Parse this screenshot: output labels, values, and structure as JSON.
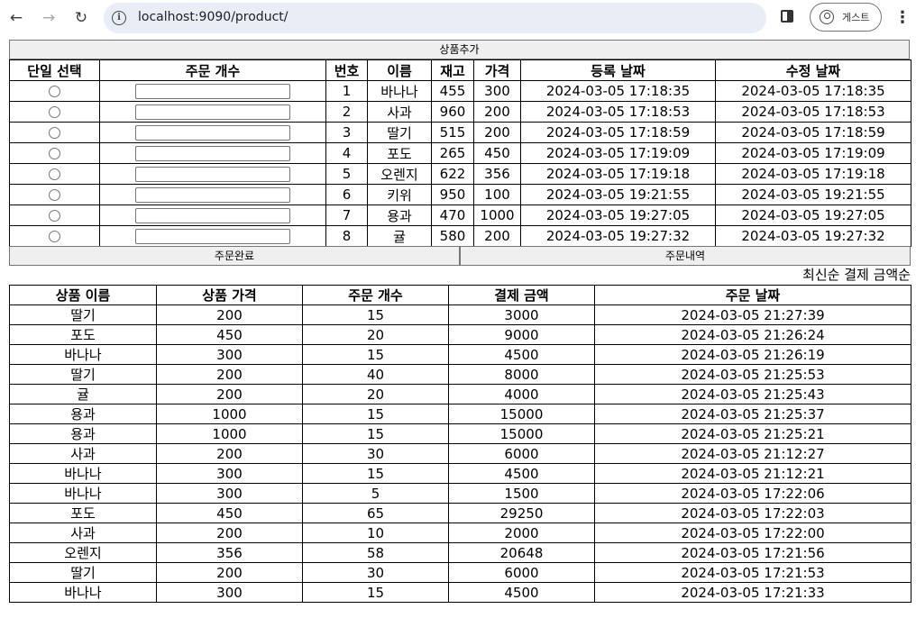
{
  "browser": {
    "url": "localhost:9090/product/",
    "profile_label": "게스트"
  },
  "add_button": "상품추가",
  "product_table": {
    "headers": [
      "단일 선택",
      "주문 개수",
      "번호",
      "이름",
      "재고",
      "가격",
      "등록 날짜",
      "수정 날짜"
    ],
    "rows": [
      [
        "1",
        "바나나",
        "455",
        "300",
        "2024-03-05 17:18:35",
        "2024-03-05 17:18:35"
      ],
      [
        "2",
        "사과",
        "960",
        "200",
        "2024-03-05 17:18:53",
        "2024-03-05 17:18:53"
      ],
      [
        "3",
        "딸기",
        "515",
        "200",
        "2024-03-05 17:18:59",
        "2024-03-05 17:18:59"
      ],
      [
        "4",
        "포도",
        "265",
        "450",
        "2024-03-05 17:19:09",
        "2024-03-05 17:19:09"
      ],
      [
        "5",
        "오렌지",
        "622",
        "356",
        "2024-03-05 17:19:18",
        "2024-03-05 17:19:18"
      ],
      [
        "6",
        "키위",
        "950",
        "100",
        "2024-03-05 19:21:55",
        "2024-03-05 19:21:55"
      ],
      [
        "7",
        "용과",
        "470",
        "1000",
        "2024-03-05 19:27:05",
        "2024-03-05 19:27:05"
      ],
      [
        "8",
        "귤",
        "580",
        "200",
        "2024-03-05 19:27:32",
        "2024-03-05 19:27:32"
      ]
    ]
  },
  "order_complete_button": "주문완료",
  "order_history_button": "주문내역",
  "sort_options": [
    "최신순",
    "결제 금액순"
  ],
  "order_table": {
    "headers": [
      "상품 이름",
      "상품 가격",
      "주문 개수",
      "결제 금액",
      "주문 날짜"
    ],
    "rows": [
      [
        "딸기",
        "200",
        "15",
        "3000",
        "2024-03-05 21:27:39"
      ],
      [
        "포도",
        "450",
        "20",
        "9000",
        "2024-03-05 21:26:24"
      ],
      [
        "바나나",
        "300",
        "15",
        "4500",
        "2024-03-05 21:26:19"
      ],
      [
        "딸기",
        "200",
        "40",
        "8000",
        "2024-03-05 21:25:53"
      ],
      [
        "귤",
        "200",
        "20",
        "4000",
        "2024-03-05 21:25:43"
      ],
      [
        "용과",
        "1000",
        "15",
        "15000",
        "2024-03-05 21:25:37"
      ],
      [
        "용과",
        "1000",
        "15",
        "15000",
        "2024-03-05 21:25:21"
      ],
      [
        "사과",
        "200",
        "30",
        "6000",
        "2024-03-05 21:12:27"
      ],
      [
        "바나나",
        "300",
        "15",
        "4500",
        "2024-03-05 21:12:21"
      ],
      [
        "바나나",
        "300",
        "5",
        "1500",
        "2024-03-05 17:22:06"
      ],
      [
        "포도",
        "450",
        "65",
        "29250",
        "2024-03-05 17:22:03"
      ],
      [
        "사과",
        "200",
        "10",
        "2000",
        "2024-03-05 17:22:00"
      ],
      [
        "오렌지",
        "356",
        "58",
        "20648",
        "2024-03-05 17:21:56"
      ],
      [
        "딸기",
        "200",
        "30",
        "6000",
        "2024-03-05 17:21:53"
      ],
      [
        "바나나",
        "300",
        "15",
        "4500",
        "2024-03-05 17:21:33"
      ]
    ]
  }
}
